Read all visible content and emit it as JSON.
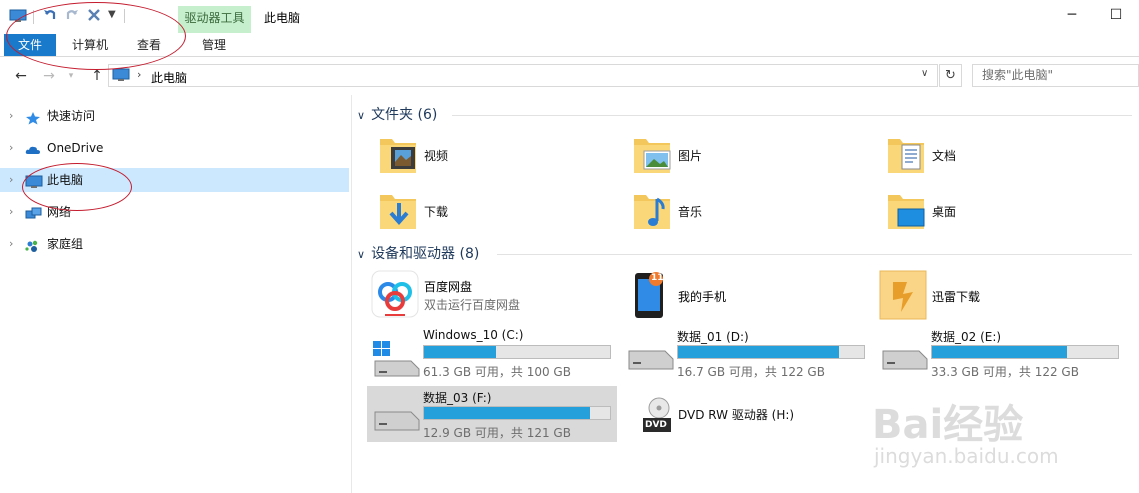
{
  "window": {
    "title": "此电脑",
    "minimize_glyph": "─",
    "maximize_glyph": "☐"
  },
  "ribbon": {
    "context_group": "驱动器工具",
    "tabs": [
      {
        "label": "文件",
        "active": true
      },
      {
        "label": "计算机"
      },
      {
        "label": "查看"
      },
      {
        "label": "管理"
      }
    ]
  },
  "address": {
    "path_item": "此电脑",
    "search_placeholder": "搜索\"此电脑\""
  },
  "nav_pane": {
    "items": [
      {
        "label": "快速访问",
        "icon": "star-icon"
      },
      {
        "label": "OneDrive",
        "icon": "cloud-icon"
      },
      {
        "label": "此电脑",
        "icon": "pc-icon",
        "selected": true
      },
      {
        "label": "网络",
        "icon": "network-icon"
      },
      {
        "label": "家庭组",
        "icon": "homegroup-icon"
      }
    ]
  },
  "folders": {
    "header": "文件夹 (6)",
    "items": [
      {
        "label": "视频",
        "icon": "videos-folder-icon"
      },
      {
        "label": "图片",
        "icon": "pictures-folder-icon"
      },
      {
        "label": "文档",
        "icon": "documents-folder-icon"
      },
      {
        "label": "下载",
        "icon": "downloads-folder-icon"
      },
      {
        "label": "音乐",
        "icon": "music-folder-icon"
      },
      {
        "label": "桌面",
        "icon": "desktop-folder-icon"
      }
    ]
  },
  "devices": {
    "header": "设备和驱动器 (8)",
    "apps": [
      {
        "label": "百度网盘",
        "sub": "双击运行百度网盘",
        "icon": "baidu-netdisk-icon"
      },
      {
        "label": "我的手机",
        "icon": "phone-icon",
        "badge": "11"
      },
      {
        "label": "迅雷下载",
        "icon": "xunlei-icon"
      }
    ],
    "drives": [
      {
        "name": "Windows_10 (C:)",
        "size": "61.3 GB 可用，共 100 GB",
        "used_fraction": 0.387
      },
      {
        "name": "数据_01 (D:)",
        "size": "16.7 GB 可用，共 122 GB",
        "used_fraction": 0.863
      },
      {
        "name": "数据_02 (E:)",
        "size": "33.3 GB 可用，共 122 GB",
        "used_fraction": 0.727
      },
      {
        "name": "数据_03 (F:)",
        "size": "12.9 GB 可用，共 121 GB",
        "used_fraction": 0.893,
        "selected": true
      }
    ],
    "dvd": {
      "name": "DVD RW 驱动器 (H:)",
      "icon_text": "DVD"
    }
  },
  "watermark": {
    "text": "Bai经验",
    "sub": "jingyan.baidu.com"
  },
  "colors": {
    "accent": "#1979ca",
    "bar": "#26a0da",
    "selection": "#cce8ff",
    "annotation": "#c41c2e"
  }
}
